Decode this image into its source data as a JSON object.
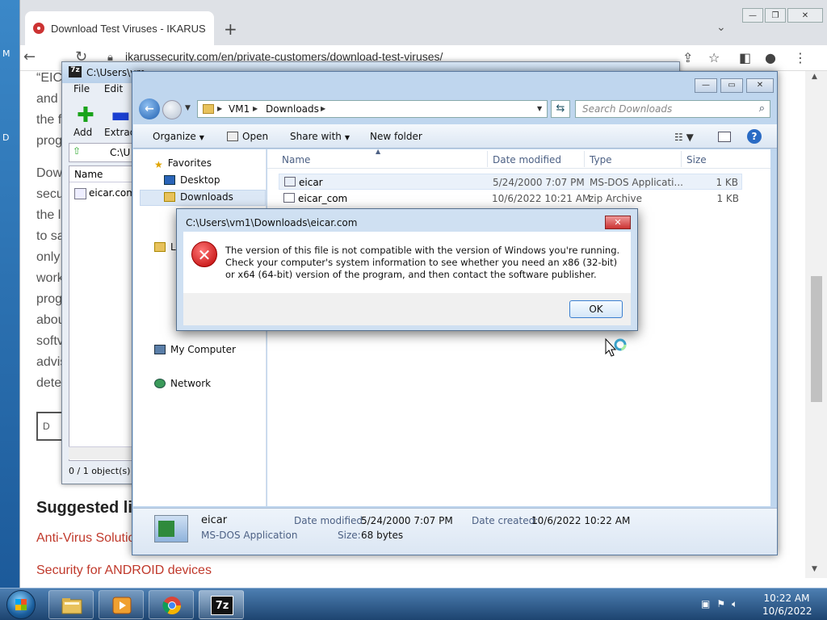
{
  "desktop": {
    "left_glyphs": [
      "M",
      "D"
    ]
  },
  "browser": {
    "tab_title": "Download Test Viruses - IKARUS",
    "newtab_glyph": "+",
    "url": "ikarussecurity.com/en/private-customers/download-test-viruses/",
    "page_lines": [
      "“EIC",
      "and",
      "the f",
      "prog",
      "Dow",
      "secu",
      "the l",
      "to sa",
      "only",
      "work",
      "prog",
      "abou",
      "softv",
      "advis",
      "dete"
    ],
    "download_button_label": "D",
    "suggested_heading": "Suggested li",
    "links": [
      "Anti-Virus Solutio",
      "Security for ANDROID devices"
    ]
  },
  "sevenzip": {
    "title": "C:\\Users\\vm",
    "icon_text": "7z",
    "menu": [
      "File",
      "Edit",
      "V"
    ],
    "tools": {
      "add": "Add",
      "extract": "Extract"
    },
    "path": "C:\\U",
    "column_name": "Name",
    "row": "eicar.com",
    "status": "0 / 1 object(s) s"
  },
  "explorer": {
    "breadcrumb": [
      "VM1",
      "Downloads"
    ],
    "search_placeholder": "Search Downloads",
    "commands": {
      "organize": "Organize",
      "open": "Open",
      "share": "Share with",
      "newfolder": "New folder"
    },
    "nav": {
      "favorites": "Favorites",
      "desktop": "Desktop",
      "downloads": "Downloads",
      "libraries": "L",
      "computer": "My Computer",
      "network": "Network"
    },
    "columns": {
      "name": "Name",
      "date": "Date modified",
      "type": "Type",
      "size": "Size"
    },
    "files": [
      {
        "name": "eicar",
        "date": "5/24/2000 7:07 PM",
        "type": "MS-DOS Applicati...",
        "size": "1 KB"
      },
      {
        "name": "eicar_com",
        "date": "10/6/2022 10:21 AM",
        "type": "zip Archive",
        "size": "1 KB"
      }
    ],
    "details": {
      "name": "eicar",
      "kind": "MS-DOS Application",
      "modified_label": "Date modified:",
      "modified": "5/24/2000 7:07 PM",
      "size_label": "Size:",
      "size": "68 bytes",
      "created_label": "Date created:",
      "created": "10/6/2022 10:22 AM"
    }
  },
  "dialog": {
    "title": "C:\\Users\\vm1\\Downloads\\eicar.com",
    "message": "The version of this file is not compatible with the version of Windows you're running. Check your computer's system information to see whether you need an x86 (32-bit) or x64 (64-bit) version of the program, and then contact the software publisher.",
    "ok": "OK"
  },
  "taskbar": {
    "time": "10:22 AM",
    "date": "10/6/2022",
    "sevenzip_label": "7z"
  },
  "colors": {
    "accent": "#2a6bc4",
    "error": "#cc1111",
    "link": "#c0392b"
  }
}
